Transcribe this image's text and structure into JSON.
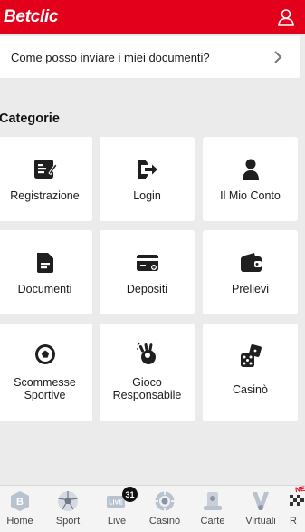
{
  "header": {
    "logo": "Betclic",
    "user_icon": "user-icon"
  },
  "faq": {
    "question": "Come posso inviare i miei documenti?",
    "chevron_icon": "chevron-right-icon"
  },
  "categories": {
    "title": "Categorie",
    "tiles": [
      {
        "label": "Registrazione",
        "icon": "registration-icon"
      },
      {
        "label": "Login",
        "icon": "login-icon"
      },
      {
        "label": "Il Mio Conto",
        "icon": "account-icon"
      },
      {
        "label": "Documenti",
        "icon": "document-icon"
      },
      {
        "label": "Depositi",
        "icon": "deposit-card-icon"
      },
      {
        "label": "Prelievi",
        "icon": "wallet-icon"
      },
      {
        "label": "Scommesse Sportive",
        "icon": "football-icon"
      },
      {
        "label": "Gioco Responsabile",
        "icon": "ok-hand-icon"
      },
      {
        "label": "Casinò",
        "icon": "dice-icon"
      }
    ]
  },
  "bottom_nav": {
    "items": [
      {
        "label": "Home",
        "icon": "betclic-home-icon"
      },
      {
        "label": "Sport",
        "icon": "soccer-ball-icon"
      },
      {
        "label": "Live",
        "icon": "live-icon",
        "badge": "31"
      },
      {
        "label": "Casinò",
        "icon": "chip-icon"
      },
      {
        "label": "Carte",
        "icon": "cards-icon"
      },
      {
        "label": "Virtuali",
        "icon": "virtual-icon"
      },
      {
        "label": "R",
        "icon": "racing-flag-icon",
        "tag": "NEW"
      }
    ]
  },
  "colors": {
    "brand": "#e2001a",
    "background": "#ebebeb",
    "tile": "#ffffff",
    "icon": "#1f1f1f"
  }
}
